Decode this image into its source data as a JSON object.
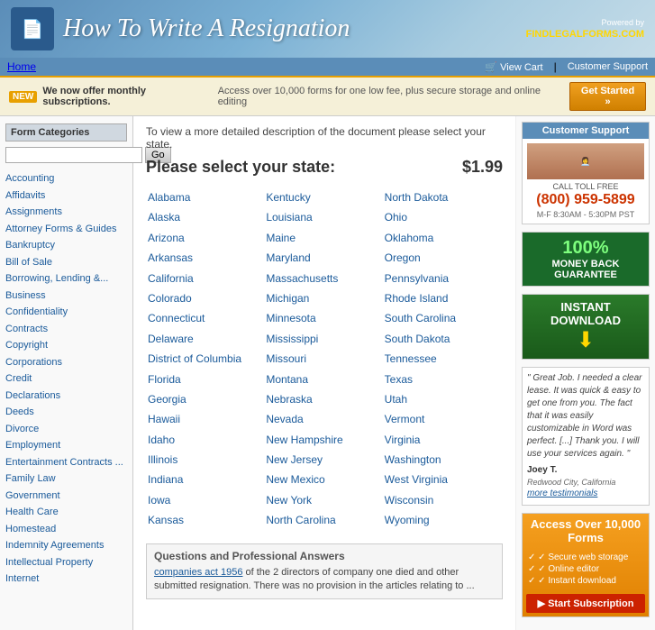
{
  "header": {
    "title": "How To Write A Resignation",
    "powered_by": "Powered by",
    "brand": "FINDLEGALFORMS.COM"
  },
  "navbar": {
    "home": "Home",
    "view_cart": "View Cart",
    "customer_support": "Customer Support"
  },
  "banner": {
    "new_label": "NEW",
    "bold": "We now offer monthly subscriptions.",
    "description": "Access over 10,000 forms for one low fee, plus secure storage and online editing",
    "cta": "Get Started »"
  },
  "sidebar": {
    "title": "Form Categories",
    "search_placeholder": "",
    "search_btn": "Go",
    "links": [
      "Accounting",
      "Affidavits",
      "Assignments",
      "Attorney Forms & Guides",
      "Bankruptcy",
      "Bill of Sale",
      "Borrowing, Lending &...",
      "Business",
      "Confidentiality",
      "Contracts",
      "Copyright",
      "Corporations",
      "Credit",
      "Declarations",
      "Deeds",
      "Divorce",
      "Employment",
      "Entertainment Contracts ...",
      "Family Law",
      "Government",
      "Health Care",
      "Homestead",
      "Indemnity Agreements",
      "Intellectual Property",
      "Internet"
    ]
  },
  "content": {
    "intro": "To view a more detailed description of the document please select your state.",
    "select_label": "Please select your state:",
    "price": "$1.99",
    "states_col1": [
      "Alabama",
      "Alaska",
      "Arizona",
      "Arkansas",
      "California",
      "Colorado",
      "Connecticut",
      "Delaware",
      "District of Columbia",
      "Florida",
      "Georgia",
      "Hawaii",
      "Idaho",
      "Illinois",
      "Indiana",
      "Iowa",
      "Kansas"
    ],
    "states_col2": [
      "Kentucky",
      "Louisiana",
      "Maine",
      "Maryland",
      "Massachusetts",
      "Michigan",
      "Minnesota",
      "Mississippi",
      "Missouri",
      "Montana",
      "Nebraska",
      "Nevada",
      "New Hampshire",
      "New Jersey",
      "New Mexico",
      "New York",
      "North Carolina"
    ],
    "states_col3": [
      "North Dakota",
      "Ohio",
      "Oklahoma",
      "Oregon",
      "Pennsylvania",
      "Rhode Island",
      "South Carolina",
      "South Dakota",
      "Tennessee",
      "Texas",
      "Utah",
      "Vermont",
      "Virginia",
      "Washington",
      "West Virginia",
      "Wisconsin",
      "Wyoming"
    ]
  },
  "qa": {
    "title": "Questions and Professional Answers",
    "text": "companies act 1956 of the 2 directors of company one died and other submitted resignation. There was no provision in the articles relating to ...",
    "link": "companies act 1956"
  },
  "right_sidebar": {
    "support": {
      "header": "Customer Support",
      "label": "CALL TOLL FREE",
      "phone": "(800) 959-5899",
      "hours": "M-F 8:30AM - 5:30PM PST"
    },
    "guarantee": {
      "line1": "100%",
      "line2": "MONEY BACK",
      "line3": "GUARANTEE"
    },
    "download": {
      "title": "INSTANT DOWNLOAD"
    },
    "testimonial": {
      "quote": "\" Great Job. I needed a clear lease. It was quick & easy to get one from you. The fact that it was easily customizable in Word was perfect. [...] Thank you. I will use your services again. \"",
      "name": "Joey T.",
      "location": "Redwood City, California",
      "more": "more testimonials"
    },
    "access": {
      "title": "Access Over 10,000 Forms",
      "features": [
        "Secure web storage",
        "Online editor",
        "Instant download"
      ],
      "cta": "▶ Start Subscription"
    }
  }
}
